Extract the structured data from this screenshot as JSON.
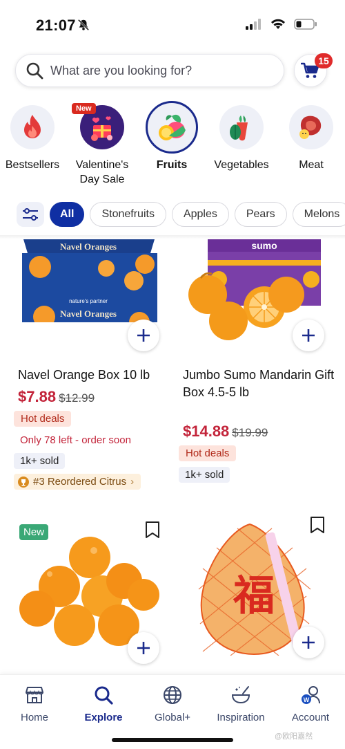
{
  "status_bar": {
    "time": "21:07"
  },
  "search": {
    "placeholder": "What are you looking for?"
  },
  "cart": {
    "badge": "15"
  },
  "categories": [
    {
      "label": "Bestsellers"
    },
    {
      "label": "Valentine's Day Sale",
      "tag": "New"
    },
    {
      "label": "Fruits",
      "selected": true
    },
    {
      "label": "Vegetables"
    },
    {
      "label": "Meat"
    }
  ],
  "filters": [
    "All",
    "Stonefruits",
    "Apples",
    "Pears",
    "Melons"
  ],
  "products": [
    {
      "title": "Navel Orange Box 10 lb",
      "price": "$7.88",
      "old_price": "$12.99",
      "tag": "Hot deals",
      "stock_note": "Only 78 left - order soon",
      "sold": "1k+ sold",
      "rank": "#3 Reordered Citrus",
      "image_text_top": "Navel Oranges",
      "image_text_brand": "nature's partner",
      "image_text_bottom": "Navel Oranges"
    },
    {
      "title": "Jumbo Sumo Mandarin Gift Box 4.5-5 lb",
      "price": "$14.88",
      "old_price": "$19.99",
      "tag": "Hot deals",
      "sold": "1k+ sold",
      "image_text": "sumo"
    },
    {
      "badge": "New"
    },
    {
      "image_text": "福"
    }
  ],
  "tabs": [
    {
      "label": "Home"
    },
    {
      "label": "Explore",
      "active": true
    },
    {
      "label": "Global+"
    },
    {
      "label": "Inspiration"
    },
    {
      "label": "Account"
    }
  ],
  "watermark": "@欧阳嘉然",
  "colors": {
    "brand": "#1a2a8c",
    "accent_chip": "#0f2fa3",
    "price": "#c3243a",
    "badge": "#e02b2b"
  }
}
